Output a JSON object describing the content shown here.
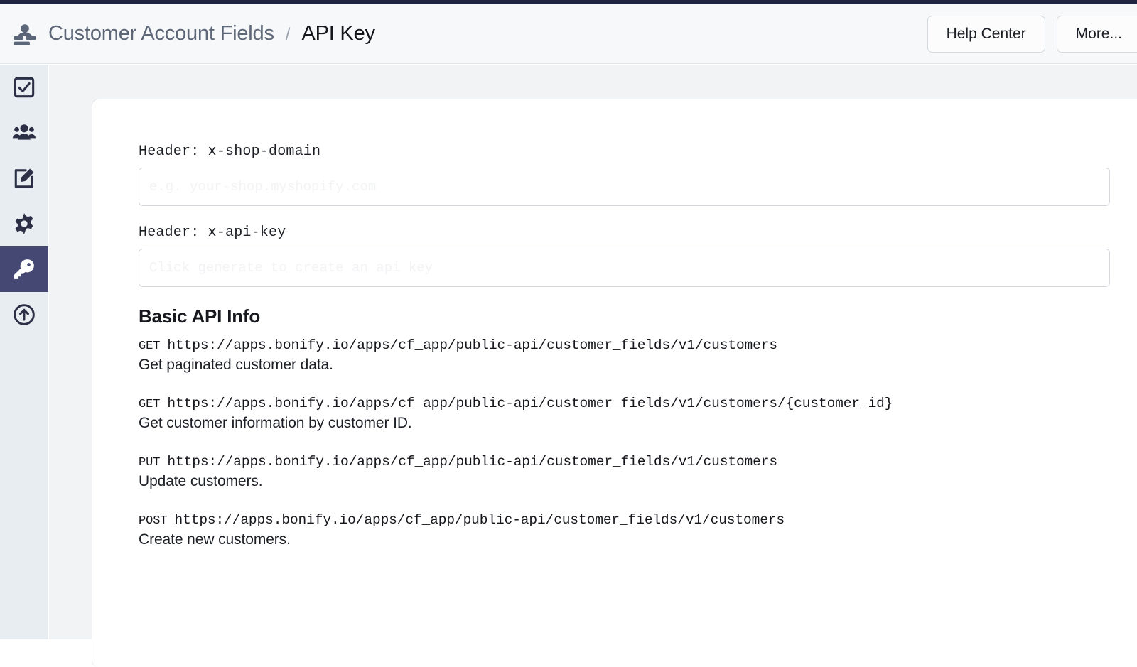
{
  "top_strip_color": "#1f2340",
  "header": {
    "app_icon": "customer-account-icon",
    "breadcrumb": {
      "app_name": "Customer Account Fields",
      "separator": "/",
      "page_name": "API Key"
    },
    "buttons": [
      {
        "label": "Help Center",
        "name": "help-center-button"
      },
      {
        "label": "More...",
        "name": "more-button"
      }
    ]
  },
  "sidebar": {
    "active_color": "#454873",
    "background_color": "#e8edf2",
    "items": [
      {
        "icon": "checkbox-icon",
        "name": "sidebar-item-fields",
        "active": false
      },
      {
        "icon": "people-icon",
        "name": "sidebar-item-customers",
        "active": false
      },
      {
        "icon": "edit-icon",
        "name": "sidebar-item-forms",
        "active": false
      },
      {
        "icon": "gear-icon",
        "name": "sidebar-item-settings",
        "active": false
      },
      {
        "icon": "key-icon",
        "name": "sidebar-item-api-key",
        "active": true
      },
      {
        "icon": "upload-icon",
        "name": "sidebar-item-import",
        "active": false
      }
    ]
  },
  "main": {
    "fields": [
      {
        "label": "Header: x-shop-domain",
        "value": "",
        "placeholder": "e.g. your-shop.myshopify.com"
      },
      {
        "label": "Header: x-api-key",
        "value": "",
        "placeholder": "Click generate to create an api key"
      }
    ],
    "api_info": {
      "title": "Basic API Info",
      "endpoints": [
        {
          "method": "GET",
          "url": "https://apps.bonify.io/apps/cf_app/public-api/customer_fields/v1/customers",
          "description": "Get paginated customer data."
        },
        {
          "method": "GET",
          "url": "https://apps.bonify.io/apps/cf_app/public-api/customer_fields/v1/customers/{customer_id}",
          "description": "Get customer information by customer ID."
        },
        {
          "method": "PUT",
          "url": "https://apps.bonify.io/apps/cf_app/public-api/customer_fields/v1/customers",
          "description": "Update customers."
        },
        {
          "method": "POST",
          "url": "https://apps.bonify.io/apps/cf_app/public-api/customer_fields/v1/customers",
          "description": "Create new customers."
        }
      ]
    }
  }
}
